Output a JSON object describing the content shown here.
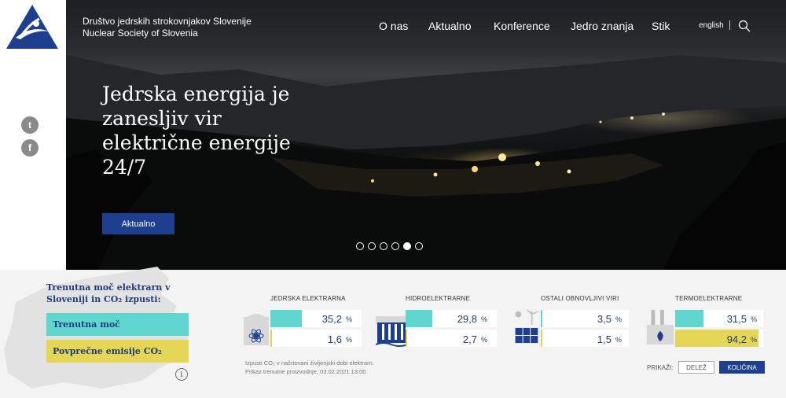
{
  "header": {
    "title_line1": "Društvo jedrskih strokovnjakov Slovenije",
    "title_line2": "Nuclear Society of Slovenia",
    "nav": [
      "O nas",
      "Aktualno",
      "Konference",
      "Jedro znanja",
      "Stik"
    ],
    "lang": "english"
  },
  "hero": {
    "headline": "Jedrska energija je zanesljiv vir električne energije 24/7",
    "button": "Aktualno",
    "slides": 6,
    "active_slide": 5
  },
  "panel": {
    "title": "Trenutna moč elektrarn v Sloveniji in CO₂ izpusti:",
    "legend_power": "Trenutna moč",
    "legend_emissions": "Povprečne emisije CO₂",
    "info": "i"
  },
  "plants": [
    {
      "label": "JEDRSKA ELEKTRARNA",
      "power": "35,2",
      "emissions": "1,6",
      "power_frac": 0.352,
      "em_frac": 0.016
    },
    {
      "label": "HIDROELEKTRARNE",
      "power": "29,8",
      "emissions": "2,7",
      "power_frac": 0.298,
      "em_frac": 0.027
    },
    {
      "label": "OSTALI OBNOVLJIVI VIRI",
      "power": "3,5",
      "emissions": "1,5",
      "power_frac": 0.035,
      "em_frac": 0.015
    },
    {
      "label": "TERMOELEKTRARNE",
      "power": "31,5",
      "emissions": "94,2",
      "power_frac": 0.315,
      "em_frac": 0.942
    }
  ],
  "unit": "%",
  "footnote_line1": "Izpusti CO₂ v načrtovani življenjski dobi elektrarn.",
  "footnote_line2": "Prikaz trenutne proizvodnje, 03.02.2021 13:00",
  "display": {
    "label": "PRIKAŽI:",
    "share": "DELEŽ",
    "quantity": "KOLIČINA"
  },
  "colors": {
    "brand": "#1e3f8f",
    "power": "#5fd7cf",
    "emissions": "#e6d655"
  }
}
